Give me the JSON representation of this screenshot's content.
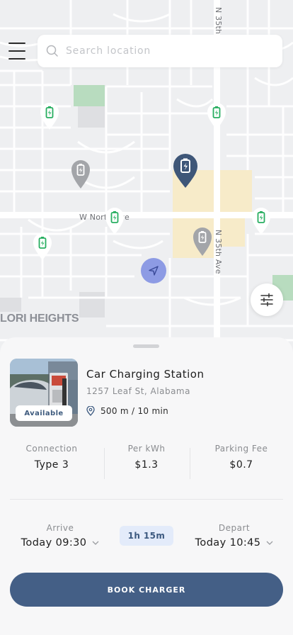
{
  "map": {
    "area_label": "LORI HEIGHTS",
    "street_horizontal": "W North Ave",
    "street_vertical_top": "N 35th",
    "street_vertical_mid": "N 35th Ave"
  },
  "search": {
    "placeholder": "Search location",
    "value": ""
  },
  "station": {
    "name": "Car Charging Station",
    "address": "1257 Leaf St, Alabama",
    "distance": "500 m / 10 min",
    "status": "Available"
  },
  "details": [
    {
      "label": "Connection",
      "value": "Type 3"
    },
    {
      "label": "Per kWh",
      "value": "$1.3"
    },
    {
      "label": "Parking Fee",
      "value": "$0.7"
    }
  ],
  "schedule": {
    "arrive_label": "Arrive",
    "arrive_value": "Today 09:30",
    "duration": "1h 15m",
    "depart_label": "Depart",
    "depart_value": "Today 10:45"
  },
  "cta": {
    "label": "BOOK CHARGER"
  },
  "colors": {
    "primary": "#445f86",
    "pin_green": "#27ae60",
    "pin_gray": "#a3a5a9",
    "pin_selected": "#3e5678",
    "nav_blue": "#8d9be4",
    "duration_bg": "#e3ebfa"
  },
  "icons": {
    "menu": "hamburger-icon",
    "search": "search-icon",
    "filter": "sliders-icon",
    "location": "location-pin-icon",
    "chevron": "chevron-down-icon",
    "navigation": "navigation-arrow-icon",
    "charger_pin": "battery-charging-pin-icon"
  }
}
